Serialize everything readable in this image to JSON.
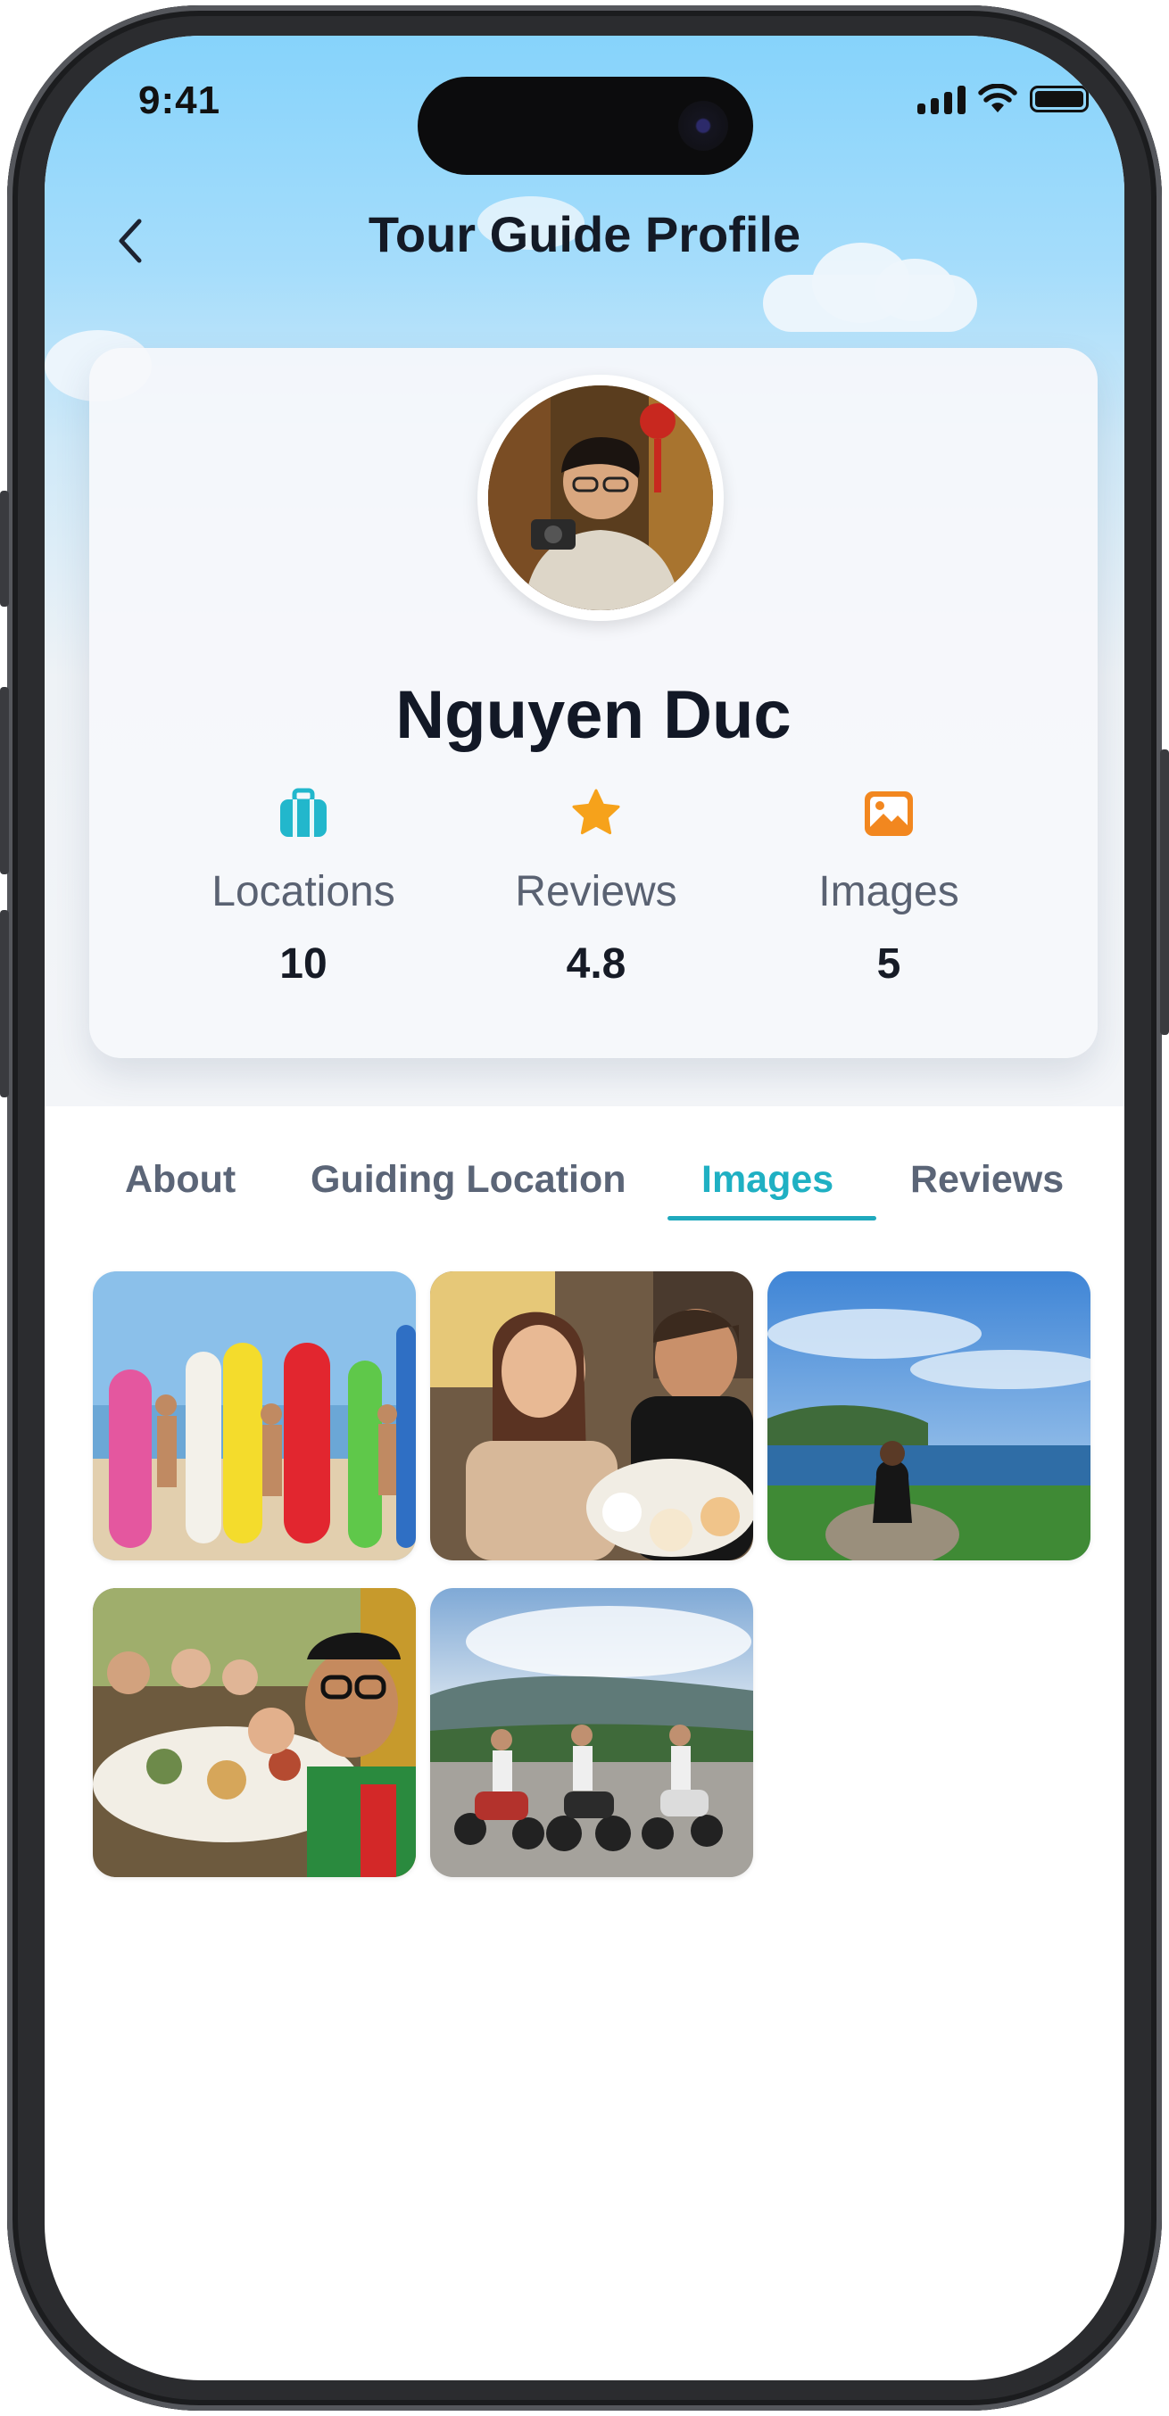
{
  "status_bar": {
    "time": "9:41"
  },
  "header": {
    "title": "Tour Guide Profile",
    "back_icon": "chevron-left-icon"
  },
  "profile": {
    "name": "Nguyen Duc",
    "stats": [
      {
        "label": "Locations",
        "value": "10",
        "icon": "briefcase-icon",
        "color": "#22b7cc"
      },
      {
        "label": "Reviews",
        "value": "4.8",
        "icon": "star-icon",
        "color": "#f6a21b"
      },
      {
        "label": "Images",
        "value": "5",
        "icon": "image-icon",
        "color": "#f2871f"
      }
    ]
  },
  "tabs": [
    {
      "label": "About",
      "active": false
    },
    {
      "label": "Guiding Location",
      "active": false
    },
    {
      "label": "Images",
      "active": true
    },
    {
      "label": "Reviews",
      "active": false
    }
  ],
  "colors": {
    "accent": "#1fb0c3",
    "title": "#141a26",
    "muted": "#5b6577"
  }
}
